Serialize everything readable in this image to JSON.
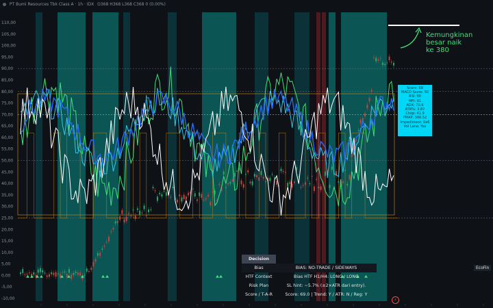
{
  "header": {
    "title": "PT Bumi Resources Tbk Class A · 1h · IDX",
    "ohlc": "O368 H368 L368 C368 0 (0.00%)"
  },
  "chart_data": {
    "type": "line",
    "yticks": [
      "110,00",
      "105,00",
      "100,00",
      "95,00",
      "90,00",
      "85,00",
      "80,00",
      "75,00",
      "70,00",
      "65,00",
      "60,00",
      "55,00",
      "50,00",
      "45,00",
      "40,00",
      "35,00",
      "30,00",
      "25,00",
      "20,00",
      "15,00",
      "10,00",
      "5,00",
      "0,00",
      "-5,00",
      "-10,00"
    ],
    "ylim": [
      -10,
      110
    ],
    "hlines": [
      90,
      80,
      70,
      50,
      25
    ],
    "colors": {
      "rsi": "#ffffff",
      "stoch": "#3fe07a",
      "cyan": "#38c6e8",
      "blue": "#2a6cf0",
      "band": "#0a8f8a",
      "band_dark": "#0a4e56",
      "orange": "#c98a1a",
      "candle_up": "#2ea36b",
      "candle_down": "#c0463f"
    },
    "teal_bands": [
      [
        84,
        125
      ],
      [
        135,
        173
      ],
      [
        295,
        345
      ],
      [
        480,
        490
      ],
      [
        498,
        565
      ]
    ],
    "dark_bands": [
      [
        52,
        62
      ],
      [
        180,
        190
      ],
      [
        245,
        258
      ],
      [
        372,
        392
      ],
      [
        430,
        452
      ]
    ],
    "red_bands": [
      [
        462,
        468
      ],
      [
        470,
        476
      ]
    ]
  },
  "annotation": {
    "line1": "Kemungkinan besar naik",
    "line2": "ke 380"
  },
  "info_box": [
    "Score: 69",
    "MACD Score: 50",
    "RSI: 80",
    "MFI: 81",
    "ADX: 70.6",
    "ATR%: 3.87",
    "Chop: 41.9",
    "PMAP: 366.52",
    "Impediment: 0x6",
    "Vol Lane: Yes"
  ],
  "decision": {
    "header": "Decision",
    "rows": [
      {
        "k": "Bias",
        "v": "BIAS: NO-TRADE / SIDEWAYS"
      },
      {
        "k": "HTF Context",
        "v": "Bias HTF H1/H4: LONG / LONG"
      },
      {
        "k": "Risk Plan",
        "v": "SL hint: ~5.7% (±2×ATR dari entry)."
      },
      {
        "k": "Score / T-A-R",
        "v": "Score: 69.0 | Trend: Y / ATR: N / Reg: Y"
      }
    ]
  },
  "eco_label": "EcoFin",
  "lightning": "⚡"
}
